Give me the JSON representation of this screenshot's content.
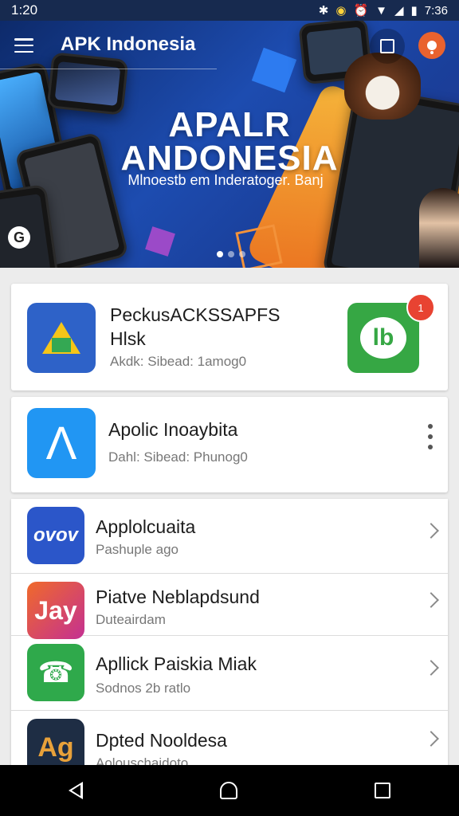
{
  "status_bar": {
    "time_left": "1:20",
    "time_right": "7:36"
  },
  "header": {
    "title": "APK Indonesia"
  },
  "banner": {
    "title_line1": "APALR",
    "title_line2": "ANDONESIA",
    "subtitle": "Mlnoestb em Inderatoger. Banj",
    "slides_total": 3,
    "slide_active": 1
  },
  "featured": [
    {
      "title_line1": "PeckusACKSSAPFS",
      "title_line2": "Hlsk",
      "subtitle": "Akdk: Sibead: 1amog0",
      "badge": "1"
    },
    {
      "title": "Apolic Inoaybita",
      "subtitle": "Dahl: Sibead: Phunog0"
    }
  ],
  "app_list": [
    {
      "title": "Applolcuaita",
      "subtitle": "Pashuple ago",
      "icon_text": "ovov"
    },
    {
      "title": "Piatve Neblapdsund",
      "subtitle": "Duteairdam",
      "icon_text": "Jay"
    },
    {
      "title": "Apllick Paiskia Miak",
      "subtitle": "Sodnos 2b ratlo",
      "icon_text": "☎"
    },
    {
      "title": "Dpted Nooldesa",
      "subtitle": "Aolouschaidoto",
      "icon_text": "Ag"
    }
  ],
  "icons": {
    "menu": "hamburger-menu-icon",
    "window": "square-icon",
    "pin": "location-pin-icon",
    "more": "more-vert-icon",
    "chevron": "chevron-right-icon",
    "nav_back": "back-triangle-icon",
    "nav_home": "home-icon",
    "nav_recent": "recent-apps-icon"
  },
  "colors": {
    "status_bar": "#172a4f",
    "banner_blue": "#1d4cb0",
    "banner_orange": "#e8631a",
    "badge_red": "#e84332",
    "green": "#36a744"
  }
}
